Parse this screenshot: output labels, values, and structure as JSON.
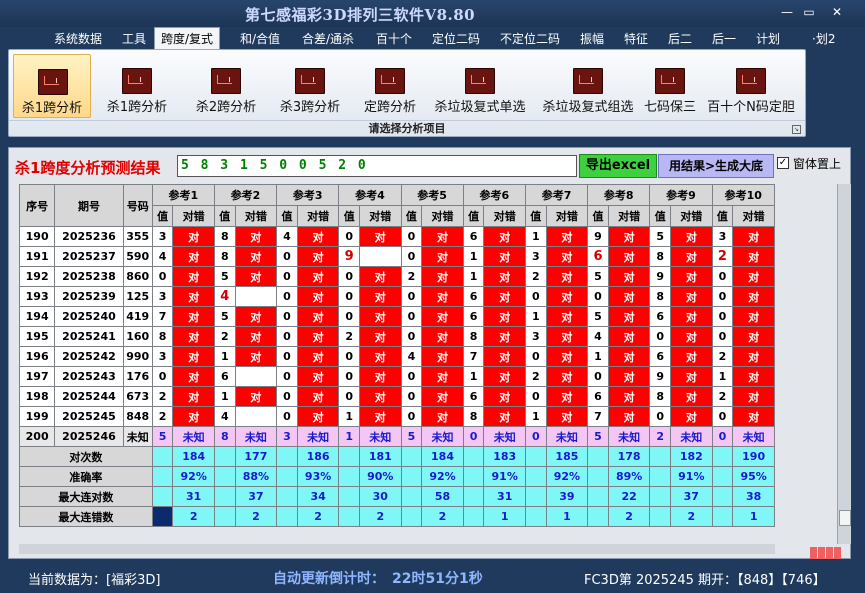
{
  "app": {
    "title": "第七感福彩3D排列三软件V8.80",
    "win_minimize": "—",
    "win_restore": "▭",
    "win_close": "✕"
  },
  "menu": [
    {
      "label": "系统数据",
      "active": false
    },
    {
      "label": "工具",
      "active": false
    },
    {
      "label": "跨度/复式",
      "active": true
    },
    {
      "label": "和/合值",
      "active": false
    },
    {
      "label": "合差/通杀",
      "active": false
    },
    {
      "label": "百十个",
      "active": false
    },
    {
      "label": "定位二码",
      "active": false
    },
    {
      "label": "不定位二码",
      "active": false
    },
    {
      "label": "振幅",
      "active": false
    },
    {
      "label": "特征",
      "active": false
    },
    {
      "label": "后二",
      "active": false
    },
    {
      "label": "后一",
      "active": false
    },
    {
      "label": "计划",
      "active": false
    },
    {
      "label": "·划2",
      "active": false
    }
  ],
  "ribbon": {
    "buttons": [
      {
        "label": "杀1跨分析",
        "icon": "chart-icon",
        "active": true
      },
      {
        "label": "杀1跨分析",
        "icon": "chart-icon",
        "active": false
      },
      {
        "label": "杀2跨分析",
        "icon": "chart-icon",
        "active": false
      },
      {
        "label": "杀3跨分析",
        "icon": "chart-icon",
        "active": false
      },
      {
        "label": "定跨分析",
        "icon": "chart-icon",
        "active": false
      },
      {
        "label": "杀垃圾复式单选",
        "icon": "chart-icon",
        "active": false
      },
      {
        "label": "杀垃圾复式组选",
        "icon": "chart-icon",
        "active": false
      },
      {
        "label": "七码保三",
        "icon": "chart-icon",
        "active": false
      },
      {
        "label": "百十个N码定胆",
        "icon": "chart-icon",
        "active": false
      }
    ],
    "footer": "请选择分析项目",
    "expand_glyph": "↘"
  },
  "panel": {
    "title": "杀1跨度分析预测结果",
    "result": "5 8 3 1 5 0 0 5 2 0",
    "export_label": "导出excel",
    "generate_label": "用结果>生成大底",
    "topmost_checked": true,
    "topmost_check_glyph": "✓",
    "topmost_label": "窗体置上"
  },
  "table": {
    "col_seq": "序号",
    "col_issue": "期号",
    "col_number": "号码",
    "ref_groups": [
      "参考1",
      "参考2",
      "参考3",
      "参考4",
      "参考5",
      "参考6",
      "参考7",
      "参考8",
      "参考9",
      "参考10"
    ],
    "sub_val": "值",
    "sub_ok": "对错",
    "ok_text": "对",
    "rows": [
      {
        "seq": "190",
        "issue": "2025236",
        "number": "355",
        "vals": [
          "3",
          "8",
          "4",
          "0",
          "0",
          "6",
          "1",
          "9",
          "5",
          "3"
        ],
        "ok": [
          true,
          true,
          true,
          true,
          true,
          true,
          true,
          true,
          true,
          true
        ]
      },
      {
        "seq": "191",
        "issue": "2025237",
        "number": "590",
        "vals": [
          "4",
          "8",
          "0",
          "9",
          "0",
          "1",
          "3",
          "6",
          "8",
          "2"
        ],
        "ok": [
          true,
          true,
          true,
          false,
          true,
          true,
          true,
          true,
          true,
          true
        ]
      },
      {
        "seq": "192",
        "issue": "2025238",
        "number": "860",
        "vals": [
          "0",
          "5",
          "0",
          "0",
          "2",
          "1",
          "2",
          "5",
          "9",
          "0"
        ],
        "ok": [
          true,
          true,
          true,
          true,
          true,
          true,
          true,
          true,
          true,
          true
        ]
      },
      {
        "seq": "193",
        "issue": "2025239",
        "number": "125",
        "vals": [
          "3",
          "4",
          "0",
          "0",
          "0",
          "6",
          "0",
          "0",
          "8",
          "0"
        ],
        "ok": [
          true,
          false,
          true,
          true,
          true,
          true,
          true,
          true,
          true,
          true
        ]
      },
      {
        "seq": "194",
        "issue": "2025240",
        "number": "419",
        "vals": [
          "7",
          "5",
          "0",
          "0",
          "0",
          "6",
          "1",
          "5",
          "6",
          "0"
        ],
        "ok": [
          true,
          true,
          true,
          true,
          true,
          true,
          true,
          true,
          true,
          true
        ]
      },
      {
        "seq": "195",
        "issue": "2025241",
        "number": "160",
        "vals": [
          "8",
          "2",
          "0",
          "2",
          "0",
          "8",
          "3",
          "4",
          "0",
          "0"
        ],
        "ok": [
          true,
          true,
          true,
          true,
          true,
          true,
          true,
          true,
          true,
          true
        ]
      },
      {
        "seq": "196",
        "issue": "2025242",
        "number": "990",
        "vals": [
          "3",
          "1",
          "0",
          "0",
          "4",
          "7",
          "0",
          "1",
          "6",
          "2"
        ],
        "ok": [
          true,
          true,
          true,
          true,
          true,
          true,
          true,
          true,
          true,
          true
        ]
      },
      {
        "seq": "197",
        "issue": "2025243",
        "number": "176",
        "vals": [
          "0",
          "6",
          "0",
          "0",
          "0",
          "1",
          "2",
          "0",
          "9",
          "1"
        ],
        "ok": [
          true,
          false,
          true,
          true,
          true,
          true,
          true,
          true,
          true,
          true
        ]
      },
      {
        "seq": "198",
        "issue": "2025244",
        "number": "673",
        "vals": [
          "2",
          "1",
          "0",
          "0",
          "0",
          "6",
          "0",
          "6",
          "8",
          "2"
        ],
        "ok": [
          true,
          true,
          true,
          true,
          true,
          true,
          true,
          true,
          true,
          true
        ]
      },
      {
        "seq": "199",
        "issue": "2025245",
        "number": "848",
        "vals": [
          "2",
          "4",
          "0",
          "1",
          "0",
          "8",
          "1",
          "7",
          "0",
          "0"
        ],
        "ok": [
          true,
          false,
          true,
          true,
          true,
          true,
          true,
          true,
          true,
          true
        ]
      }
    ],
    "red_vals": [
      [
        1,
        3
      ],
      [
        3,
        1
      ],
      [
        7,
        1
      ],
      [
        9,
        1
      ]
    ],
    "pending": {
      "seq": "200",
      "issue": "2025246",
      "number": "未知",
      "vals": [
        "5",
        "8",
        "3",
        "1",
        "5",
        "0",
        "0",
        "5",
        "2",
        "0"
      ],
      "status": "未知"
    },
    "stats": [
      {
        "label": "对次数",
        "values": [
          "184",
          "177",
          "186",
          "181",
          "184",
          "183",
          "185",
          "178",
          "182",
          "190"
        ]
      },
      {
        "label": "准确率",
        "values": [
          "92%",
          "88%",
          "93%",
          "90%",
          "92%",
          "91%",
          "92%",
          "89%",
          "91%",
          "95%"
        ]
      },
      {
        "label": "最大连对数",
        "values": [
          "31",
          "37",
          "34",
          "30",
          "58",
          "31",
          "39",
          "22",
          "37",
          "38"
        ]
      },
      {
        "label": "最大连错数",
        "values": [
          "2",
          "2",
          "2",
          "2",
          "2",
          "1",
          "1",
          "2",
          "2",
          "1"
        ]
      }
    ]
  },
  "status": {
    "current": "当前数据为：[福彩3D]",
    "countdown": "自动更新倒计时：　22时51分1秒",
    "issue": "FC3D第 2025245 期开：【848】【746】"
  }
}
